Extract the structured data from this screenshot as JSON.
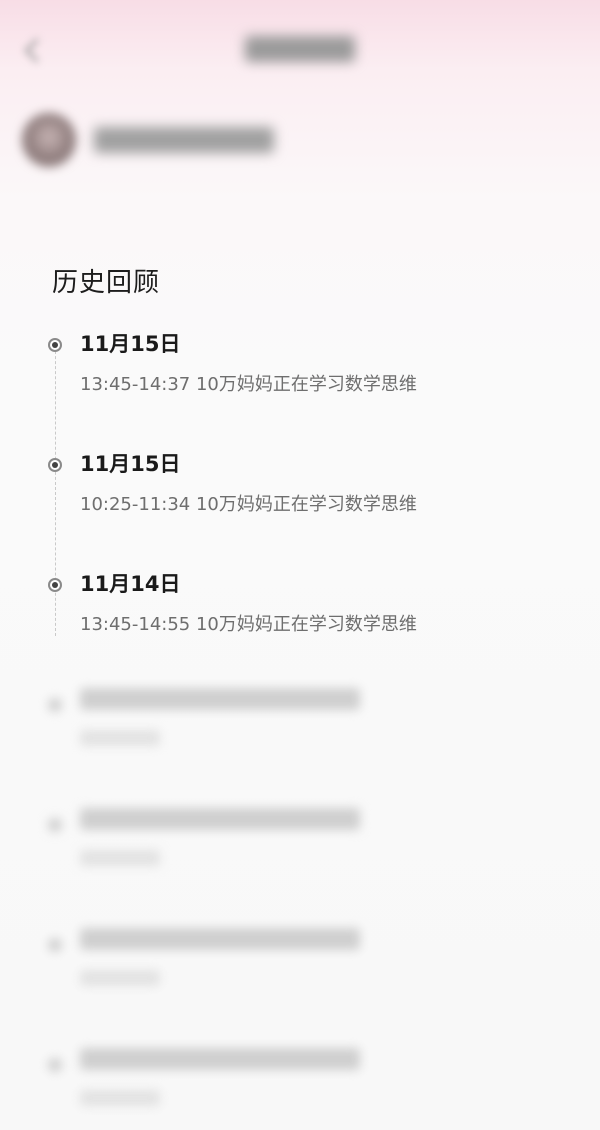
{
  "header": {
    "title": "",
    "room_name": ""
  },
  "section_title": "历史回顾",
  "history": [
    {
      "date": "11月15日",
      "description": "13:45-14:37 10万妈妈正在学习数学思维"
    },
    {
      "date": "11月15日",
      "description": "10:25-11:34 10万妈妈正在学习数学思维"
    },
    {
      "date": "11月14日",
      "description": "13:45-14:55 10万妈妈正在学习数学思维"
    }
  ],
  "blurred_history": [
    {
      "date": "",
      "description": ""
    },
    {
      "date": "",
      "description": ""
    },
    {
      "date": "",
      "description": ""
    },
    {
      "date": "",
      "description": ""
    }
  ],
  "colors": {
    "header_gradient_top": "#f8dde6",
    "background": "#fafafa",
    "title_text": "#1d1d1d",
    "desc_text": "#6e6e6e"
  },
  "icons": {
    "back": "chevron-left-icon",
    "timeline_marker": "radio-dot-icon"
  }
}
